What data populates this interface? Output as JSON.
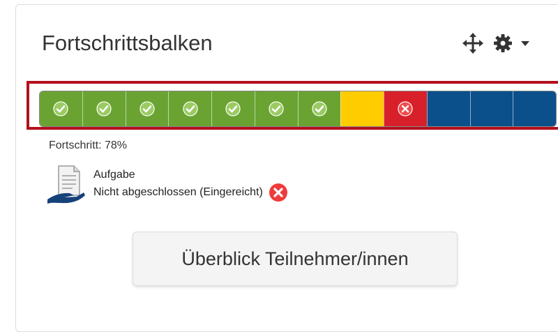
{
  "block": {
    "title": "Fortschrittsbalken",
    "header_icons": [
      "move-icon",
      "gear-icon",
      "caret-down-icon"
    ]
  },
  "progress_bar": {
    "segments": [
      {
        "status": "complete",
        "icon": "check-icon"
      },
      {
        "status": "complete",
        "icon": "check-icon"
      },
      {
        "status": "complete",
        "icon": "check-icon"
      },
      {
        "status": "complete",
        "icon": "check-icon"
      },
      {
        "status": "complete",
        "icon": "check-icon"
      },
      {
        "status": "complete",
        "icon": "check-icon"
      },
      {
        "status": "complete",
        "icon": "check-icon"
      },
      {
        "status": "submitted",
        "icon": ""
      },
      {
        "status": "failed",
        "icon": "cross-icon"
      },
      {
        "status": "future",
        "icon": ""
      },
      {
        "status": "future",
        "icon": ""
      },
      {
        "status": "future",
        "icon": ""
      }
    ],
    "colors": {
      "complete": "#6aa332",
      "submitted": "#ffcc00",
      "failed": "#d8202b",
      "future": "#0b4f8b",
      "highlight_border": "#b3101d"
    },
    "progress_label": "Fortschritt: 78%"
  },
  "activity": {
    "icon": "assignment-icon",
    "name": "Aufgabe",
    "status": "Nicht abgeschlossen (Eingereicht)",
    "status_icon": "red-cross-icon"
  },
  "overview_button": {
    "label": "Überblick Teilnehmer/innen"
  }
}
